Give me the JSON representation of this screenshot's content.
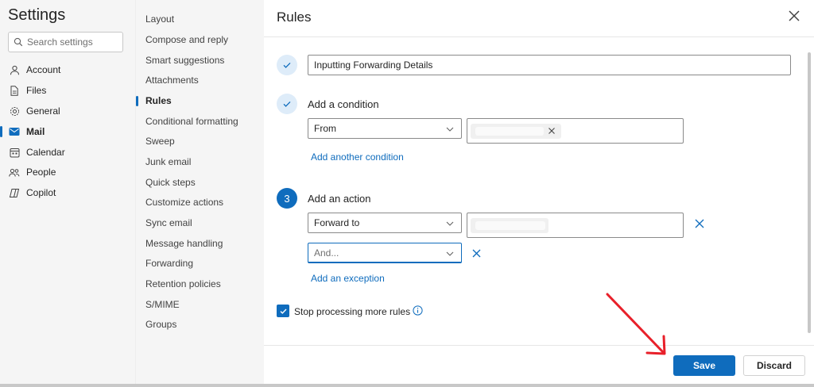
{
  "app": {
    "title": "Settings",
    "search": {
      "placeholder": "Search settings"
    }
  },
  "nav": {
    "items": [
      {
        "label": "Account",
        "icon": "person-icon",
        "active": false
      },
      {
        "label": "Files",
        "icon": "file-icon",
        "active": false
      },
      {
        "label": "General",
        "icon": "gear-icon",
        "active": false
      },
      {
        "label": "Mail",
        "icon": "mail-icon",
        "active": true
      },
      {
        "label": "Calendar",
        "icon": "calendar-icon",
        "active": false
      },
      {
        "label": "People",
        "icon": "people-icon",
        "active": false
      },
      {
        "label": "Copilot",
        "icon": "copilot-icon",
        "active": false
      }
    ]
  },
  "mail_settings": {
    "items": [
      {
        "label": "Layout",
        "active": false
      },
      {
        "label": "Compose and reply",
        "active": false
      },
      {
        "label": "Smart suggestions",
        "active": false
      },
      {
        "label": "Attachments",
        "active": false
      },
      {
        "label": "Rules",
        "active": true
      },
      {
        "label": "Conditional formatting",
        "active": false
      },
      {
        "label": "Sweep",
        "active": false
      },
      {
        "label": "Junk email",
        "active": false
      },
      {
        "label": "Quick steps",
        "active": false
      },
      {
        "label": "Customize actions",
        "active": false
      },
      {
        "label": "Sync email",
        "active": false
      },
      {
        "label": "Message handling",
        "active": false
      },
      {
        "label": "Forwarding",
        "active": false
      },
      {
        "label": "Retention policies",
        "active": false
      },
      {
        "label": "S/MIME",
        "active": false
      },
      {
        "label": "Groups",
        "active": false
      }
    ]
  },
  "rules": {
    "title": "Rules",
    "rule_name": "Inputting Forwarding Details",
    "condition": {
      "heading": "Add a condition",
      "field": "From",
      "add_link": "Add another condition"
    },
    "action": {
      "step_number": "3",
      "heading": "Add an action",
      "field": "Forward to",
      "second_placeholder": "And...",
      "exception_link": "Add an exception"
    },
    "stop_processing": {
      "label": "Stop processing more rules",
      "checked": true
    },
    "save_label": "Save",
    "discard_label": "Discard"
  },
  "colors": {
    "accent": "#0f6cbd",
    "annotation_arrow": "#e8202a"
  }
}
